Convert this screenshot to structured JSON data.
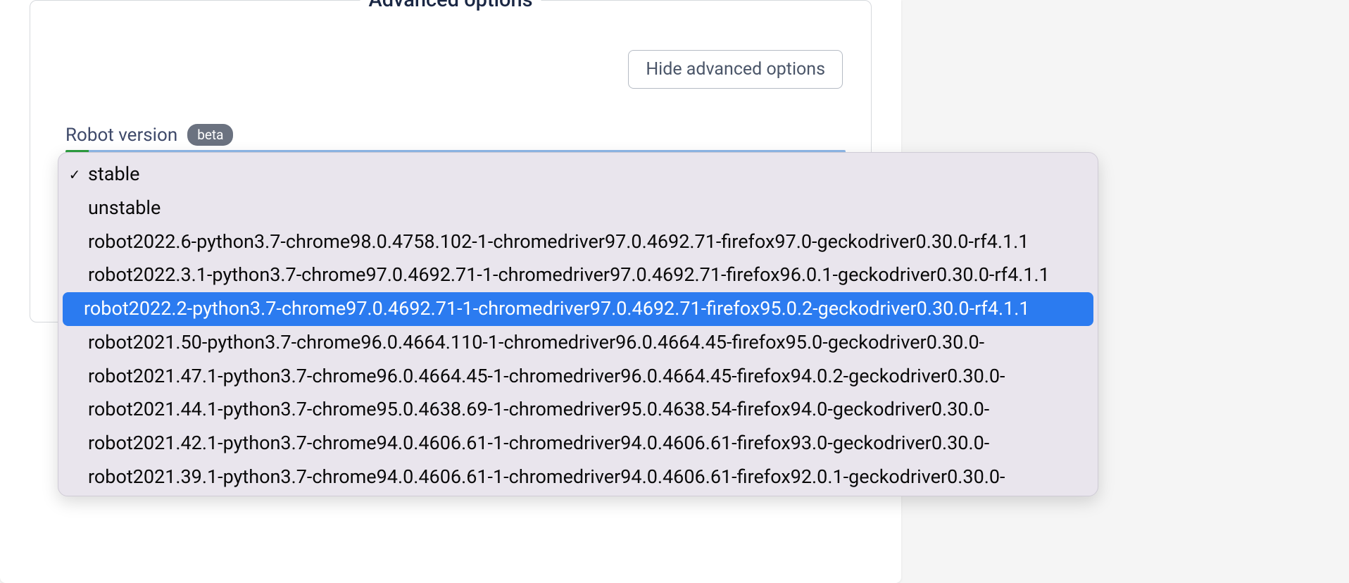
{
  "panel": {
    "legend": "Advanced options",
    "hide_button_label": "Hide advanced options"
  },
  "field": {
    "label": "Robot version",
    "badge": "beta"
  },
  "dropdown": {
    "options": [
      {
        "label": "stable",
        "selected": true,
        "highlighted": false
      },
      {
        "label": "unstable",
        "selected": false,
        "highlighted": false
      },
      {
        "label": "robot2022.6-python3.7-chrome98.0.4758.102-1-chromedriver97.0.4692.71-firefox97.0-geckodriver0.30.0-rf4.1.1",
        "selected": false,
        "highlighted": false
      },
      {
        "label": "robot2022.3.1-python3.7-chrome97.0.4692.71-1-chromedriver97.0.4692.71-firefox96.0.1-geckodriver0.30.0-rf4.1.1",
        "selected": false,
        "highlighted": false
      },
      {
        "label": "robot2022.2-python3.7-chrome97.0.4692.71-1-chromedriver97.0.4692.71-firefox95.0.2-geckodriver0.30.0-rf4.1.1",
        "selected": false,
        "highlighted": true
      },
      {
        "label": "robot2021.50-python3.7-chrome96.0.4664.110-1-chromedriver96.0.4664.45-firefox95.0-geckodriver0.30.0-",
        "selected": false,
        "highlighted": false
      },
      {
        "label": "robot2021.47.1-python3.7-chrome96.0.4664.45-1-chromedriver96.0.4664.45-firefox94.0.2-geckodriver0.30.0-",
        "selected": false,
        "highlighted": false
      },
      {
        "label": "robot2021.44.1-python3.7-chrome95.0.4638.69-1-chromedriver95.0.4638.54-firefox94.0-geckodriver0.30.0-",
        "selected": false,
        "highlighted": false
      },
      {
        "label": "robot2021.42.1-python3.7-chrome94.0.4606.61-1-chromedriver94.0.4606.61-firefox93.0-geckodriver0.30.0-",
        "selected": false,
        "highlighted": false
      },
      {
        "label": "robot2021.39.1-python3.7-chrome94.0.4606.61-1-chromedriver94.0.4606.61-firefox92.0.1-geckodriver0.30.0-",
        "selected": false,
        "highlighted": false
      }
    ]
  }
}
